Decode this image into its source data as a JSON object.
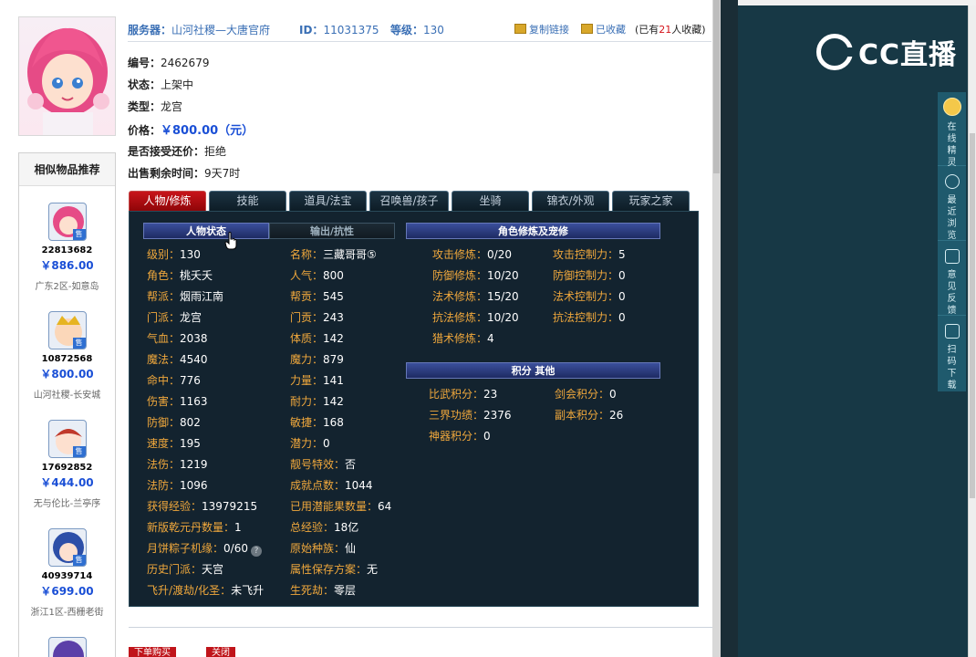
{
  "header": {
    "server_label": "服务器：",
    "server_value": "山河社稷—大唐官府",
    "id_label": "ID：",
    "id_value": "11031375",
    "level_label": "等级：",
    "level_value": "130",
    "copy_link": "复制链接",
    "favorited": "已收藏",
    "fav_prefix": "(已有",
    "fav_count": "21",
    "fav_suffix": "人收藏)"
  },
  "info": {
    "number_label": "编号：",
    "number_value": "2462679",
    "status_label": "状态：",
    "status_value": "上架中",
    "type_label": "类型：",
    "type_value": "龙宫",
    "price_label": "价格：",
    "price_value": "￥800.00（元）",
    "counter_label": "是否接受还价：",
    "counter_value": "拒绝",
    "time_label": "出售剩余时间：",
    "time_value": "9天7时"
  },
  "similar": {
    "title": "相似物品推荐",
    "sell_tag": "售",
    "items": [
      {
        "id": "22813682",
        "price": "￥886.00",
        "server": "广东2区-如意岛",
        "avatar": "pink-hair-avatar"
      },
      {
        "id": "10872568",
        "price": "￥800.00",
        "server": "山河社稷-长安城",
        "avatar": "golden-crown-avatar"
      },
      {
        "id": "17692852",
        "price": "￥444.00",
        "server": "无与伦比-兰亭序",
        "avatar": "boy-avatar"
      },
      {
        "id": "40939714",
        "price": "￥699.00",
        "server": "浙江1区-西栅老街",
        "avatar": "blue-hair-avatar"
      }
    ]
  },
  "tabs": [
    "人物/修炼",
    "技能",
    "道具/法宝",
    "召唤兽/孩子",
    "坐骑",
    "锦衣/外观",
    "玩家之家"
  ],
  "panel": {
    "sub_status": "人物状态",
    "sub_resist": "输出/抗性",
    "sub_cultivation": "角色修炼及宠修",
    "sub_points": "积分 其他",
    "left_col": [
      {
        "k": "级别：",
        "v": "130"
      },
      {
        "k": "角色：",
        "v": "桃夭夭"
      },
      {
        "k": "帮派：",
        "v": "烟雨江南"
      },
      {
        "k": "门派：",
        "v": "龙宫"
      },
      {
        "k": "气血：",
        "v": "2038"
      },
      {
        "k": "魔法：",
        "v": "4540"
      },
      {
        "k": "命中：",
        "v": "776"
      },
      {
        "k": "伤害：",
        "v": "1163"
      },
      {
        "k": "防御：",
        "v": "802"
      },
      {
        "k": "速度：",
        "v": "195"
      },
      {
        "k": "法伤：",
        "v": "1219"
      },
      {
        "k": "法防：",
        "v": "1096"
      },
      {
        "k": "获得经验：",
        "v": "13979215"
      },
      {
        "k": "新版乾元丹数量：",
        "v": "1"
      },
      {
        "k": "月饼粽子机缘：",
        "v": "0/60"
      },
      {
        "k": "历史门派：",
        "v": "天宫"
      },
      {
        "k": "飞升/渡劫/化圣：",
        "v": "未飞升"
      }
    ],
    "mid_col": [
      {
        "k": "名称：",
        "v": "三藏哥哥⑤"
      },
      {
        "k": "人气：",
        "v": "800"
      },
      {
        "k": "帮贡：",
        "v": "545"
      },
      {
        "k": "门贡：",
        "v": "243"
      },
      {
        "k": "体质：",
        "v": "142"
      },
      {
        "k": "魔力：",
        "v": "879"
      },
      {
        "k": "力量：",
        "v": "141"
      },
      {
        "k": "耐力：",
        "v": "142"
      },
      {
        "k": "敏捷：",
        "v": "168"
      },
      {
        "k": "潜力：",
        "v": "0"
      },
      {
        "k": "靓号特效：",
        "v": "否"
      },
      {
        "k": "成就点数：",
        "v": "1044"
      },
      {
        "k": "已用潜能果数量：",
        "v": "64"
      },
      {
        "k": "总经验：",
        "v": "18亿"
      },
      {
        "k": "原始种族：",
        "v": "仙"
      },
      {
        "k": "属性保存方案：",
        "v": "无"
      },
      {
        "k": "生死劫：",
        "v": "零层"
      }
    ],
    "cult_left": [
      {
        "k": "攻击修炼：",
        "v": "0/20"
      },
      {
        "k": "防御修炼：",
        "v": "10/20"
      },
      {
        "k": "法术修炼：",
        "v": "15/20"
      },
      {
        "k": "抗法修炼：",
        "v": "10/20"
      },
      {
        "k": "猎术修炼：",
        "v": "4"
      }
    ],
    "cult_right": [
      {
        "k": "攻击控制力：",
        "v": "5"
      },
      {
        "k": "防御控制力：",
        "v": "0"
      },
      {
        "k": "法术控制力：",
        "v": "0"
      },
      {
        "k": "抗法控制力：",
        "v": "0"
      }
    ],
    "points_left": [
      {
        "k": "比武积分：",
        "v": "23"
      },
      {
        "k": "三界功绩：",
        "v": "2376"
      },
      {
        "k": "神器积分：",
        "v": "0"
      }
    ],
    "points_right": [
      {
        "k": "剑会积分：",
        "v": "0"
      },
      {
        "k": "副本积分：",
        "v": "26"
      }
    ],
    "help_glyph": "?"
  },
  "bottom": {
    "buy": "下单购买",
    "close": "关闭"
  },
  "right": {
    "logo": "CC直播",
    "tools": [
      {
        "label": "在线精灵",
        "icon": "sprite-avatar-icon"
      },
      {
        "label": "最近浏览",
        "icon": "clock-icon"
      },
      {
        "label": "意见反馈",
        "icon": "edit-icon"
      },
      {
        "label": "扫码下载",
        "icon": "qr-scan-icon"
      }
    ]
  }
}
